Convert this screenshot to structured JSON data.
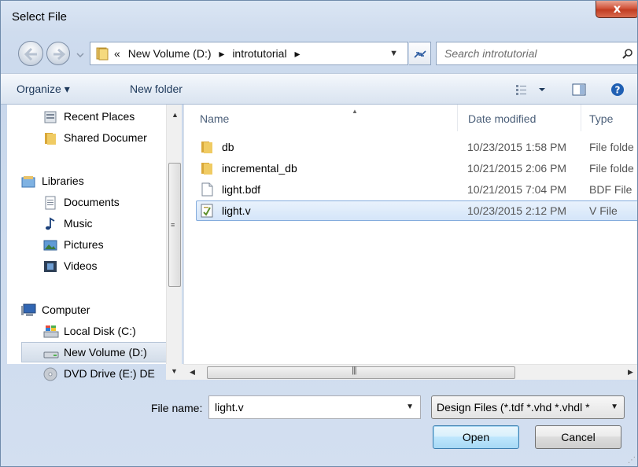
{
  "window": {
    "title": "Select File",
    "close_label": "x"
  },
  "address": {
    "prefix": "«",
    "segments": [
      "New Volume (D:)",
      "introtutorial"
    ],
    "separator": "▸"
  },
  "search": {
    "placeholder": "Search introtutorial"
  },
  "toolbar": {
    "organize_label": "Organize ▾",
    "new_folder_label": "New folder"
  },
  "nav": {
    "items": [
      {
        "label": "Recent Places",
        "icon": "recent-places-icon"
      },
      {
        "label": "Shared Documer",
        "icon": "folder-icon"
      },
      {
        "label": "Libraries",
        "icon": "libraries-icon"
      },
      {
        "label": "Documents",
        "icon": "documents-icon"
      },
      {
        "label": "Music",
        "icon": "music-icon"
      },
      {
        "label": "Pictures",
        "icon": "pictures-icon"
      },
      {
        "label": "Videos",
        "icon": "videos-icon"
      },
      {
        "label": "Computer",
        "icon": "computer-icon"
      },
      {
        "label": "Local Disk (C:)",
        "icon": "local-disk-icon"
      },
      {
        "label": "New Volume (D:)",
        "icon": "drive-icon"
      },
      {
        "label": "DVD Drive (E:) DE",
        "icon": "dvd-icon"
      }
    ],
    "selected": "New Volume (D:)"
  },
  "filelist": {
    "columns": {
      "name": "Name",
      "date": "Date modified",
      "type": "Type"
    },
    "rows": [
      {
        "name": "db",
        "date": "10/23/2015 1:58 PM",
        "type": "File folde",
        "icon": "folder-icon"
      },
      {
        "name": "incremental_db",
        "date": "10/21/2015 2:06 PM",
        "type": "File folde",
        "icon": "folder-icon"
      },
      {
        "name": "light.bdf",
        "date": "10/21/2015 7:04 PM",
        "type": "BDF File",
        "icon": "file-icon"
      },
      {
        "name": "light.v",
        "date": "10/23/2015 2:12 PM",
        "type": "V File",
        "icon": "verilog-file-icon"
      }
    ],
    "selected": "light.v"
  },
  "bottom": {
    "file_name_label": "File name:",
    "file_name_value": "light.v",
    "filter_label": "Design Files (*.tdf *.vhd *.vhdl *",
    "open_label": "Open",
    "cancel_label": "Cancel"
  },
  "colors": {
    "accent": "#84acdd",
    "close": "#c13d22",
    "title_text": "#000000"
  }
}
